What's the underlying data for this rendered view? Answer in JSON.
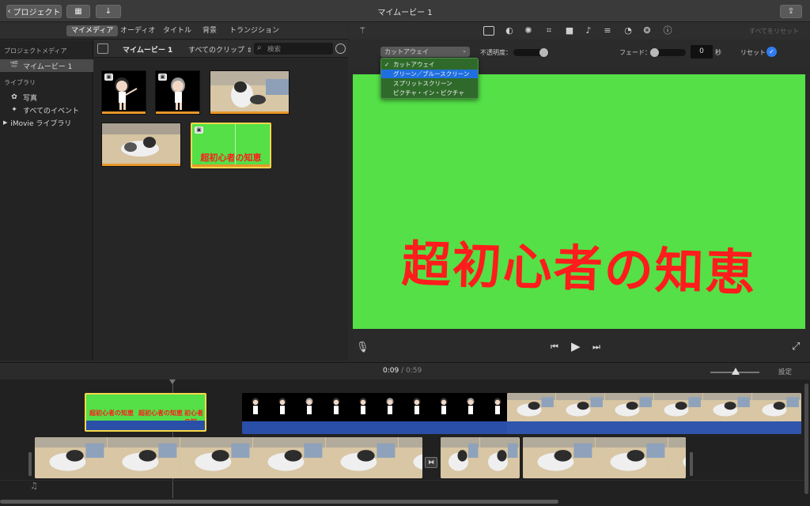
{
  "titlebar": {
    "back_label": "プロジェクト",
    "window_title": "マイムービー 1",
    "icons": [
      "chevron-left-icon",
      "film-icon",
      "download-arrow-icon",
      "share-icon"
    ]
  },
  "media_tabs": [
    "マイメディア",
    "オーディオ",
    "タイトル",
    "背景",
    "トランジション"
  ],
  "sidebar": {
    "project_media_heading": "プロジェクトメディア",
    "project_item": "マイムービー 1",
    "library_heading": "ライブラリ",
    "items": [
      "写真",
      "すべてのイベント",
      "iMovie ライブラリ"
    ]
  },
  "browser": {
    "title": "マイムービー 1",
    "filter": "すべてのクリップ",
    "search_placeholder": "検索",
    "title_clip_text": "超初心者の知恵"
  },
  "viewer": {
    "reset_all": "すべてをリセット",
    "overlay_select": "カットアウェイ",
    "opacity_label": "不透明度：",
    "fade_label": "フェード：",
    "fade_value": "0",
    "fade_unit": "秒",
    "reset_label": "リセット",
    "preview_text": "超初心者の知恵",
    "overlay_options": [
      "カットアウェイ",
      "グリーン／ブルースクリーン",
      "スプリットスクリーン",
      "ピクチャ・イン・ピクチャ"
    ],
    "overlay_checked": "カットアウェイ",
    "overlay_highlighted": "グリーン／ブルースクリーン"
  },
  "timeline": {
    "current_time": "0:09",
    "separator": "/",
    "total_time": "0:59",
    "settings_label": "設定",
    "title_clip_texts": [
      "超初心者の知恵",
      "超初心者の知恵",
      "初心者の知"
    ]
  },
  "colors": {
    "green_screen": "#54e046",
    "title_red": "#ff1c1c",
    "selection_yellow": "#f5d84a",
    "menu_highlight": "#1f6fe0",
    "audio_blue": "#2a4fa8"
  }
}
